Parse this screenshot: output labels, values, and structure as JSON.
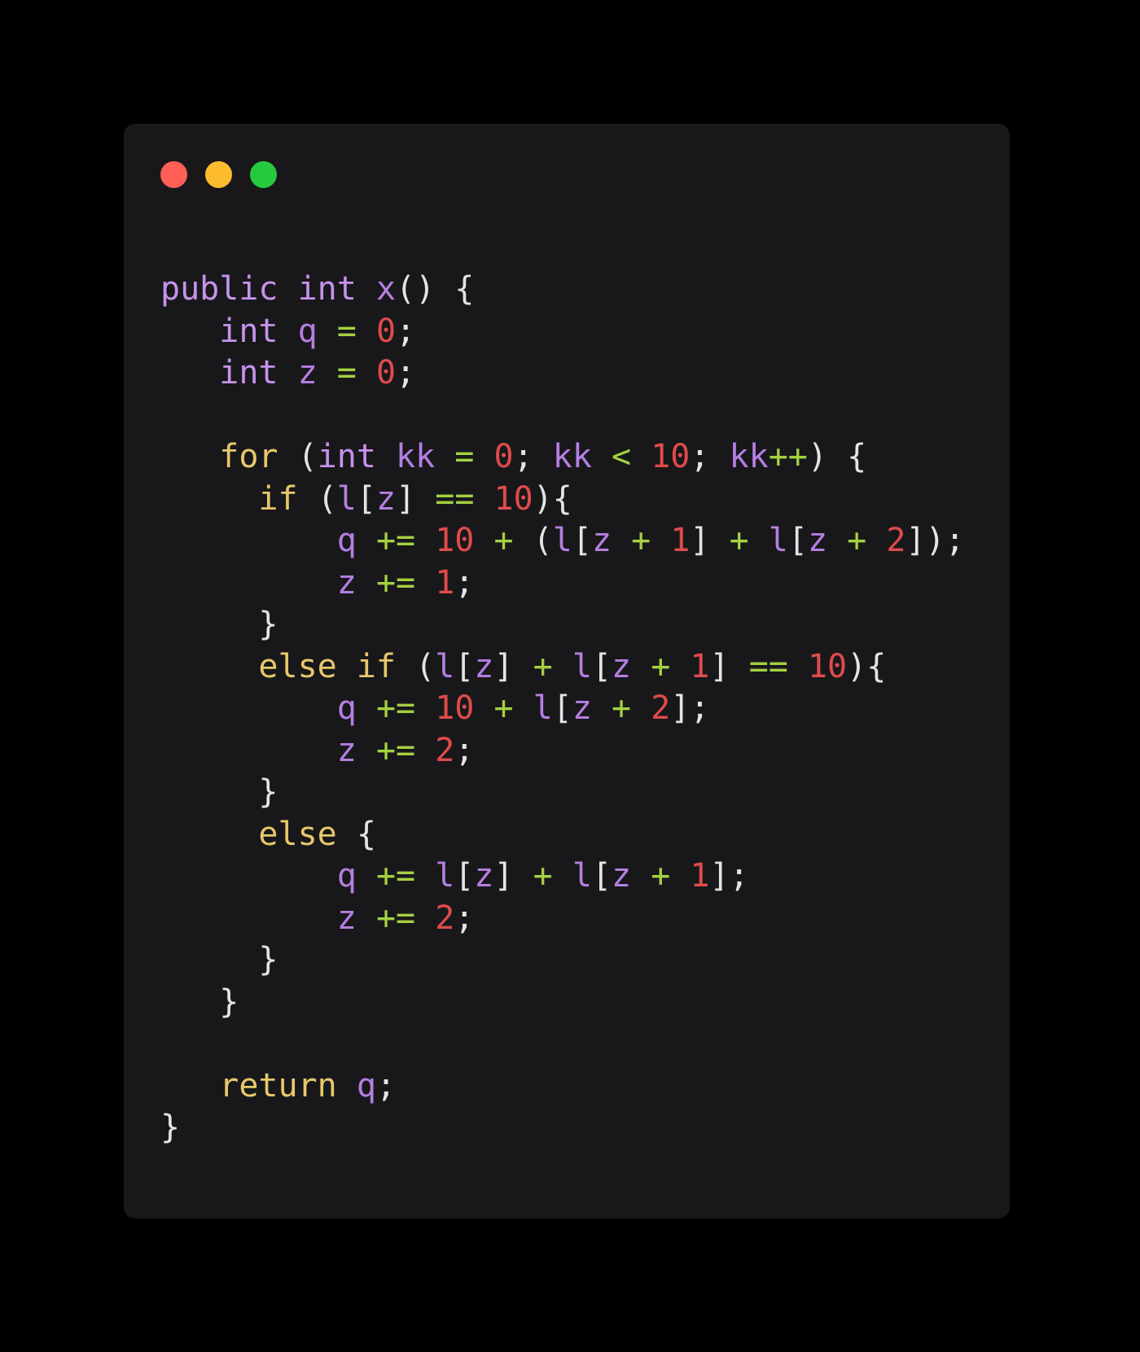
{
  "window": {
    "title": "code-snippet-window",
    "controls": [
      {
        "name": "close-button",
        "color": "#ff5f56"
      },
      {
        "name": "minimize-button",
        "color": "#fcbc2e"
      },
      {
        "name": "maximize-button",
        "color": "#27c93f"
      }
    ]
  },
  "theme": {
    "page_background": "#000000",
    "card_background": "#18181b",
    "keyword": "#c792ea",
    "control_keyword": "#e7c86a",
    "identifier": "#b57fe0",
    "operator": "#a5d141",
    "number": "#e04b4b",
    "punctuation": "#e4e4e4"
  },
  "code": {
    "language": "java",
    "plain_text": "public int x() {\n   int q = 0;\n   int z = 0;\n\n   for (int kk = 0; kk < 10; kk++) {\n     if (l[z] == 10){\n         q += 10 + (l[z + 1] + l[z + 2]);\n         z += 1;\n     }\n     else if (l[z] + l[z + 1] == 10){\n         q += 10 + l[z + 2];\n         z += 2;\n     }\n     else {\n         q += l[z] + l[z + 1];\n         z += 2;\n     }\n   }\n\n   return q;\n}",
    "lines": [
      {
        "indent": 0,
        "tokens": [
          {
            "t": "public",
            "c": "kw"
          },
          {
            "t": " ",
            "c": "pun"
          },
          {
            "t": "int",
            "c": "kw"
          },
          {
            "t": " ",
            "c": "pun"
          },
          {
            "t": "x",
            "c": "id"
          },
          {
            "t": "()",
            "c": "pun"
          },
          {
            "t": " ",
            "c": "pun"
          },
          {
            "t": "{",
            "c": "pun"
          }
        ]
      },
      {
        "indent": 3,
        "tokens": [
          {
            "t": "int",
            "c": "kw"
          },
          {
            "t": " ",
            "c": "pun"
          },
          {
            "t": "q",
            "c": "id"
          },
          {
            "t": " ",
            "c": "pun"
          },
          {
            "t": "=",
            "c": "op"
          },
          {
            "t": " ",
            "c": "pun"
          },
          {
            "t": "0",
            "c": "num"
          },
          {
            "t": ";",
            "c": "pun"
          }
        ]
      },
      {
        "indent": 3,
        "tokens": [
          {
            "t": "int",
            "c": "kw"
          },
          {
            "t": " ",
            "c": "pun"
          },
          {
            "t": "z",
            "c": "id"
          },
          {
            "t": " ",
            "c": "pun"
          },
          {
            "t": "=",
            "c": "op"
          },
          {
            "t": " ",
            "c": "pun"
          },
          {
            "t": "0",
            "c": "num"
          },
          {
            "t": ";",
            "c": "pun"
          }
        ]
      },
      {
        "indent": 0,
        "tokens": []
      },
      {
        "indent": 3,
        "tokens": [
          {
            "t": "for",
            "c": "ctl"
          },
          {
            "t": " ",
            "c": "pun"
          },
          {
            "t": "(",
            "c": "pun"
          },
          {
            "t": "int",
            "c": "kw"
          },
          {
            "t": " ",
            "c": "pun"
          },
          {
            "t": "kk",
            "c": "id"
          },
          {
            "t": " ",
            "c": "pun"
          },
          {
            "t": "=",
            "c": "op"
          },
          {
            "t": " ",
            "c": "pun"
          },
          {
            "t": "0",
            "c": "num"
          },
          {
            "t": "; ",
            "c": "pun"
          },
          {
            "t": "kk",
            "c": "id"
          },
          {
            "t": " ",
            "c": "pun"
          },
          {
            "t": "<",
            "c": "op"
          },
          {
            "t": " ",
            "c": "pun"
          },
          {
            "t": "10",
            "c": "num"
          },
          {
            "t": "; ",
            "c": "pun"
          },
          {
            "t": "kk",
            "c": "id"
          },
          {
            "t": "++",
            "c": "op"
          },
          {
            "t": ")",
            "c": "pun"
          },
          {
            "t": " ",
            "c": "pun"
          },
          {
            "t": "{",
            "c": "pun"
          }
        ]
      },
      {
        "indent": 5,
        "tokens": [
          {
            "t": "if",
            "c": "ctl"
          },
          {
            "t": " ",
            "c": "pun"
          },
          {
            "t": "(",
            "c": "pun"
          },
          {
            "t": "l",
            "c": "id"
          },
          {
            "t": "[",
            "c": "pun"
          },
          {
            "t": "z",
            "c": "id"
          },
          {
            "t": "]",
            "c": "pun"
          },
          {
            "t": " ",
            "c": "pun"
          },
          {
            "t": "==",
            "c": "op"
          },
          {
            "t": " ",
            "c": "pun"
          },
          {
            "t": "10",
            "c": "num"
          },
          {
            "t": ")",
            "c": "pun"
          },
          {
            "t": "{",
            "c": "pun"
          }
        ]
      },
      {
        "indent": 9,
        "tokens": [
          {
            "t": "q",
            "c": "id"
          },
          {
            "t": " ",
            "c": "pun"
          },
          {
            "t": "+=",
            "c": "op"
          },
          {
            "t": " ",
            "c": "pun"
          },
          {
            "t": "10",
            "c": "num"
          },
          {
            "t": " ",
            "c": "pun"
          },
          {
            "t": "+",
            "c": "op"
          },
          {
            "t": " ",
            "c": "pun"
          },
          {
            "t": "(",
            "c": "pun"
          },
          {
            "t": "l",
            "c": "id"
          },
          {
            "t": "[",
            "c": "pun"
          },
          {
            "t": "z",
            "c": "id"
          },
          {
            "t": " ",
            "c": "pun"
          },
          {
            "t": "+",
            "c": "op"
          },
          {
            "t": " ",
            "c": "pun"
          },
          {
            "t": "1",
            "c": "num"
          },
          {
            "t": "]",
            "c": "pun"
          },
          {
            "t": " ",
            "c": "pun"
          },
          {
            "t": "+",
            "c": "op"
          },
          {
            "t": " ",
            "c": "pun"
          },
          {
            "t": "l",
            "c": "id"
          },
          {
            "t": "[",
            "c": "pun"
          },
          {
            "t": "z",
            "c": "id"
          },
          {
            "t": " ",
            "c": "pun"
          },
          {
            "t": "+",
            "c": "op"
          },
          {
            "t": " ",
            "c": "pun"
          },
          {
            "t": "2",
            "c": "num"
          },
          {
            "t": "])",
            "c": "pun"
          },
          {
            "t": ";",
            "c": "pun"
          }
        ]
      },
      {
        "indent": 9,
        "tokens": [
          {
            "t": "z",
            "c": "id"
          },
          {
            "t": " ",
            "c": "pun"
          },
          {
            "t": "+=",
            "c": "op"
          },
          {
            "t": " ",
            "c": "pun"
          },
          {
            "t": "1",
            "c": "num"
          },
          {
            "t": ";",
            "c": "pun"
          }
        ]
      },
      {
        "indent": 5,
        "tokens": [
          {
            "t": "}",
            "c": "pun"
          }
        ]
      },
      {
        "indent": 5,
        "tokens": [
          {
            "t": "else",
            "c": "ctl"
          },
          {
            "t": " ",
            "c": "pun"
          },
          {
            "t": "if",
            "c": "ctl"
          },
          {
            "t": " ",
            "c": "pun"
          },
          {
            "t": "(",
            "c": "pun"
          },
          {
            "t": "l",
            "c": "id"
          },
          {
            "t": "[",
            "c": "pun"
          },
          {
            "t": "z",
            "c": "id"
          },
          {
            "t": "]",
            "c": "pun"
          },
          {
            "t": " ",
            "c": "pun"
          },
          {
            "t": "+",
            "c": "op"
          },
          {
            "t": " ",
            "c": "pun"
          },
          {
            "t": "l",
            "c": "id"
          },
          {
            "t": "[",
            "c": "pun"
          },
          {
            "t": "z",
            "c": "id"
          },
          {
            "t": " ",
            "c": "pun"
          },
          {
            "t": "+",
            "c": "op"
          },
          {
            "t": " ",
            "c": "pun"
          },
          {
            "t": "1",
            "c": "num"
          },
          {
            "t": "]",
            "c": "pun"
          },
          {
            "t": " ",
            "c": "pun"
          },
          {
            "t": "==",
            "c": "op"
          },
          {
            "t": " ",
            "c": "pun"
          },
          {
            "t": "10",
            "c": "num"
          },
          {
            "t": ")",
            "c": "pun"
          },
          {
            "t": "{",
            "c": "pun"
          }
        ]
      },
      {
        "indent": 9,
        "tokens": [
          {
            "t": "q",
            "c": "id"
          },
          {
            "t": " ",
            "c": "pun"
          },
          {
            "t": "+=",
            "c": "op"
          },
          {
            "t": " ",
            "c": "pun"
          },
          {
            "t": "10",
            "c": "num"
          },
          {
            "t": " ",
            "c": "pun"
          },
          {
            "t": "+",
            "c": "op"
          },
          {
            "t": " ",
            "c": "pun"
          },
          {
            "t": "l",
            "c": "id"
          },
          {
            "t": "[",
            "c": "pun"
          },
          {
            "t": "z",
            "c": "id"
          },
          {
            "t": " ",
            "c": "pun"
          },
          {
            "t": "+",
            "c": "op"
          },
          {
            "t": " ",
            "c": "pun"
          },
          {
            "t": "2",
            "c": "num"
          },
          {
            "t": "]",
            "c": "pun"
          },
          {
            "t": ";",
            "c": "pun"
          }
        ]
      },
      {
        "indent": 9,
        "tokens": [
          {
            "t": "z",
            "c": "id"
          },
          {
            "t": " ",
            "c": "pun"
          },
          {
            "t": "+=",
            "c": "op"
          },
          {
            "t": " ",
            "c": "pun"
          },
          {
            "t": "2",
            "c": "num"
          },
          {
            "t": ";",
            "c": "pun"
          }
        ]
      },
      {
        "indent": 5,
        "tokens": [
          {
            "t": "}",
            "c": "pun"
          }
        ]
      },
      {
        "indent": 5,
        "tokens": [
          {
            "t": "else",
            "c": "ctl"
          },
          {
            "t": " ",
            "c": "pun"
          },
          {
            "t": "{",
            "c": "pun"
          }
        ]
      },
      {
        "indent": 9,
        "tokens": [
          {
            "t": "q",
            "c": "id"
          },
          {
            "t": " ",
            "c": "pun"
          },
          {
            "t": "+=",
            "c": "op"
          },
          {
            "t": " ",
            "c": "pun"
          },
          {
            "t": "l",
            "c": "id"
          },
          {
            "t": "[",
            "c": "pun"
          },
          {
            "t": "z",
            "c": "id"
          },
          {
            "t": "]",
            "c": "pun"
          },
          {
            "t": " ",
            "c": "pun"
          },
          {
            "t": "+",
            "c": "op"
          },
          {
            "t": " ",
            "c": "pun"
          },
          {
            "t": "l",
            "c": "id"
          },
          {
            "t": "[",
            "c": "pun"
          },
          {
            "t": "z",
            "c": "id"
          },
          {
            "t": " ",
            "c": "pun"
          },
          {
            "t": "+",
            "c": "op"
          },
          {
            "t": " ",
            "c": "pun"
          },
          {
            "t": "1",
            "c": "num"
          },
          {
            "t": "]",
            "c": "pun"
          },
          {
            "t": ";",
            "c": "pun"
          }
        ]
      },
      {
        "indent": 9,
        "tokens": [
          {
            "t": "z",
            "c": "id"
          },
          {
            "t": " ",
            "c": "pun"
          },
          {
            "t": "+=",
            "c": "op"
          },
          {
            "t": " ",
            "c": "pun"
          },
          {
            "t": "2",
            "c": "num"
          },
          {
            "t": ";",
            "c": "pun"
          }
        ]
      },
      {
        "indent": 5,
        "tokens": [
          {
            "t": "}",
            "c": "pun"
          }
        ]
      },
      {
        "indent": 3,
        "tokens": [
          {
            "t": "}",
            "c": "pun"
          }
        ]
      },
      {
        "indent": 0,
        "tokens": []
      },
      {
        "indent": 3,
        "tokens": [
          {
            "t": "return",
            "c": "ctl"
          },
          {
            "t": " ",
            "c": "pun"
          },
          {
            "t": "q",
            "c": "id"
          },
          {
            "t": ";",
            "c": "pun"
          }
        ]
      },
      {
        "indent": 0,
        "tokens": [
          {
            "t": "}",
            "c": "pun"
          }
        ]
      }
    ]
  }
}
